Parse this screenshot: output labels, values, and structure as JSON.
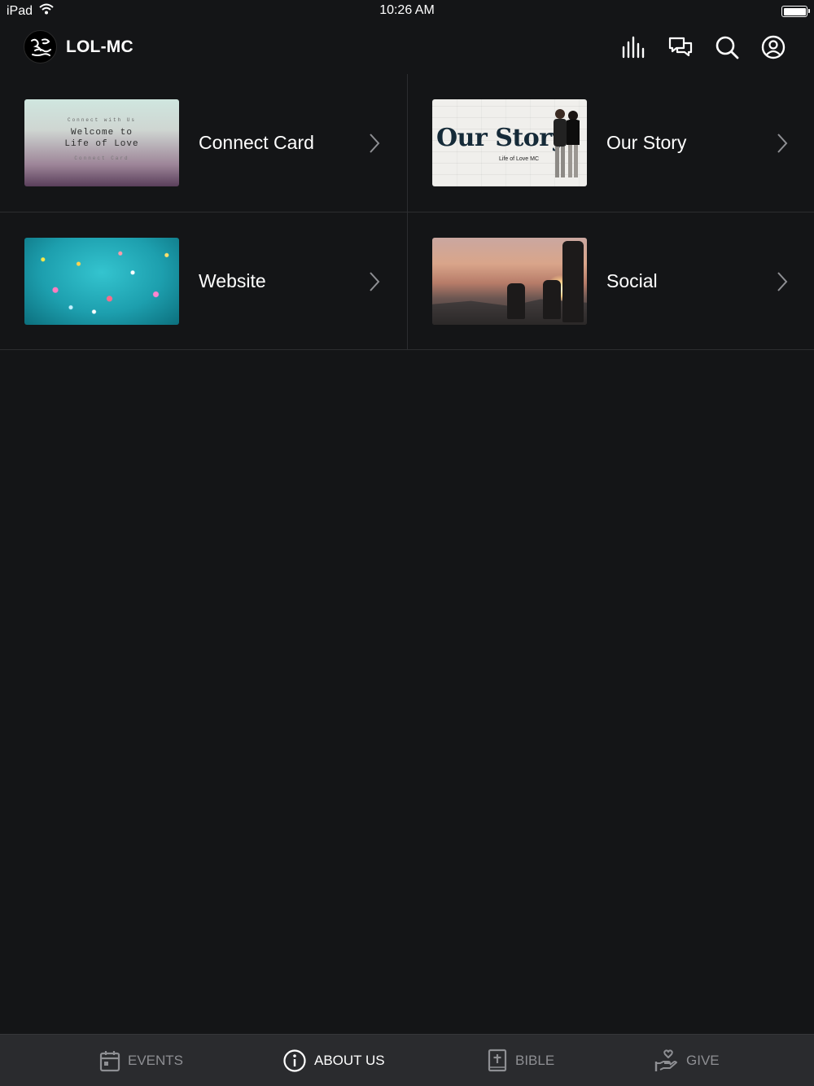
{
  "status_bar": {
    "device": "iPad",
    "time": "10:26 AM"
  },
  "header": {
    "app_title": "LOL-MC",
    "icons": [
      "equalizer-icon",
      "chat-bubbles-icon",
      "search-icon",
      "account-icon"
    ]
  },
  "tiles": [
    {
      "label": "Connect Card",
      "thumb_text": [
        "Connect with Us",
        "Welcome to",
        "Life of Love",
        "Connect Card"
      ]
    },
    {
      "label": "Our Story",
      "thumb_title": "Our Story",
      "thumb_subtitle": "Life of Love MC"
    },
    {
      "label": "Website"
    },
    {
      "label": "Social"
    }
  ],
  "tabbar": {
    "tabs": [
      {
        "label": "EVENTS",
        "icon": "calendar-icon",
        "active": false
      },
      {
        "label": "ABOUT US",
        "icon": "info-icon",
        "active": true
      },
      {
        "label": "BIBLE",
        "icon": "bible-icon",
        "active": false
      },
      {
        "label": "GIVE",
        "icon": "give-hand-icon",
        "active": false
      }
    ]
  },
  "colors": {
    "background": "#141517",
    "tabbar": "#2a2b2e",
    "text": "#ffffff",
    "inactive": "#8e8f93",
    "divider": "#2c2d30"
  }
}
